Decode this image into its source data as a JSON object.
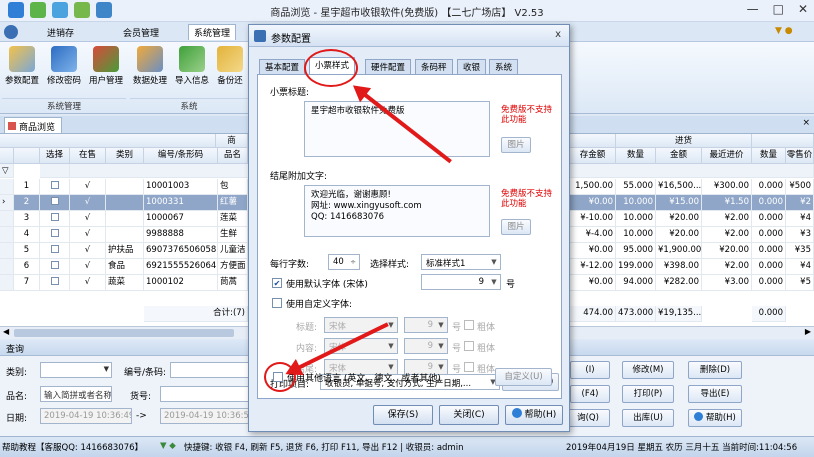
{
  "window": {
    "title": "商品浏览 - 星宇超市收银软件(免费版) 【二七广场店】 V2.53",
    "controls": [
      "—",
      "□",
      "✕"
    ]
  },
  "menu": {
    "items": [
      "进销存",
      "会员管理",
      "系统管理"
    ],
    "active_index": 2
  },
  "ribbon": {
    "buttons": [
      "参数配置",
      "修改密码",
      "用户管理",
      "数据处理",
      "导入信息",
      "备份还"
    ],
    "groups": [
      "系统管理",
      "系统"
    ]
  },
  "doc_tab": "商品浏览",
  "grid": {
    "group_header_left": "商",
    "group_header_right": "进货",
    "columns_left": [
      "选择",
      "在售",
      "类别",
      "编号/条形码",
      "品名"
    ],
    "columns_right": [
      "存金额",
      "数量",
      "金额",
      "最近进价",
      "数量",
      "零售价"
    ],
    "rows": [
      {
        "n": "1",
        "sel": false,
        "onsale": "√",
        "cat": "",
        "code": "10001003",
        "name": "包",
        "amt": "1,500.00",
        "qty": "55.000",
        "money": "¥16,500....",
        "last": "¥300.00",
        "qty2": "0.000",
        "retail": "¥500"
      },
      {
        "n": "2",
        "sel": false,
        "onsale": "√",
        "cat": "",
        "code": "1000331",
        "name": "红薯",
        "amt": "¥0.00",
        "qty": "10.000",
        "money": "¥15.00",
        "last": "¥1.50",
        "qty2": "0.000",
        "retail": "¥2"
      },
      {
        "n": "3",
        "sel": false,
        "onsale": "√",
        "cat": "",
        "code": "1000067",
        "name": "莲菜",
        "amt": "¥-10.00",
        "qty": "10.000",
        "money": "¥20.00",
        "last": "¥2.00",
        "qty2": "0.000",
        "retail": "¥4"
      },
      {
        "n": "4",
        "sel": false,
        "onsale": "√",
        "cat": "",
        "code": "9988888",
        "name": "生鲜",
        "amt": "¥-4.00",
        "qty": "10.000",
        "money": "¥20.00",
        "last": "¥2.00",
        "qty2": "0.000",
        "retail": "¥3"
      },
      {
        "n": "5",
        "sel": false,
        "onsale": "√",
        "cat": "护扶品",
        "code": "6907376506058",
        "name": "儿童洁",
        "amt": "¥0.00",
        "qty": "95.000",
        "money": "¥1,900.00",
        "last": "¥20.00",
        "qty2": "0.000",
        "retail": "¥35"
      },
      {
        "n": "6",
        "sel": false,
        "onsale": "√",
        "cat": "食品",
        "code": "6921555526064",
        "name": "方便面",
        "amt": "¥-12.00",
        "qty": "199.000",
        "money": "¥398.00",
        "last": "¥2.00",
        "qty2": "0.000",
        "retail": "¥4"
      },
      {
        "n": "7",
        "sel": false,
        "onsale": "√",
        "cat": "蔬菜",
        "code": "1000102",
        "name": "茼蒿",
        "amt": "¥0.00",
        "qty": "94.000",
        "money": "¥282.00",
        "last": "¥3.00",
        "qty2": "0.000",
        "retail": "¥5"
      }
    ],
    "footer_total_label": "合计:(7)",
    "footer_amt": "474.00",
    "footer_qty": "473.000",
    "footer_money": "¥19,135...",
    "footer_qty2": "0.000"
  },
  "query": {
    "header": "查询",
    "category_label": "类别:",
    "category_value": "",
    "code_label": "编号/条码:",
    "name_label": "品名:",
    "name_placeholder": "输入简拼或者名称",
    "goods_no_label": "货号:",
    "date_label": "日期:",
    "date_from": "2019-04-19 10:36:49",
    "date_arrow": "->",
    "date_to": "2019-04-19 10:36:5",
    "buttons": [
      "(I)",
      "修改(M)",
      "删除(D)",
      "(F4)",
      "打印(P)",
      "导出(E)",
      "询(Q)",
      "出库(U)",
      "帮助(H)"
    ]
  },
  "status": {
    "left": "帮助教程【客服QQ: 1416683076】",
    "shortcuts": "快捷键: 收银 F4, 刷新 F5, 退货 F6, 打印 F11, 导出 F12 | 收银员: admin",
    "datetime": "2019年04月19日 星期五 农历 三月十五 当前时间:11:04:56"
  },
  "dialog": {
    "title": "参数配置",
    "close": "x",
    "tabs": [
      "基本配置",
      "小票样式",
      "硬件配置",
      "条码秤",
      "收银",
      "系统"
    ],
    "active_tab": 1,
    "receipt_title_label": "小票标题:",
    "receipt_title_value": "星宇超市收银软件免费版",
    "free_notice_1": "免费版不支持此功能",
    "image_button_1": "图片",
    "footer_text_label": "结尾附加文字:",
    "footer_text_lines": [
      "欢迎光临，谢谢惠顾!",
      "网址: www.xingyusoft.com",
      "QQ: 1416683076"
    ],
    "free_notice_2": "免费版不支持此功能",
    "image_button_2": "图片",
    "chars_per_line_label": "每行字数:",
    "chars_per_line_value": "40",
    "style_label": "选择样式:",
    "style_value": "标准样式1",
    "default_font_label": "使用默认字体 (宋体)",
    "default_font_checked": true,
    "default_font_size": "9",
    "size_unit": "号",
    "custom_font_label": "使用自定义字体:",
    "custom_font_checked": false,
    "font_rows": [
      {
        "label": "标题:",
        "font": "宋体",
        "size": "9",
        "bold": "粗体"
      },
      {
        "label": "内容:",
        "font": "宋体",
        "size": "9",
        "bold": "粗体"
      },
      {
        "label": "结尾:",
        "font": "宋体",
        "size": "9",
        "bold": "粗体"
      }
    ],
    "print_items_label": "打印项目:",
    "print_items_value": "收银员, 单据号, 支付方式, 生产日期,...",
    "print_preview_button": "打印预览(P)",
    "other_lang_label": "使用其他语言 (英文、德文、或者其他)",
    "other_lang_checked": false,
    "custom_button": "自定义(U)",
    "save_button": "保存(S)",
    "close_button": "关闭(C)",
    "help_button": "帮助(H)"
  },
  "annotation_color": "#e11919"
}
